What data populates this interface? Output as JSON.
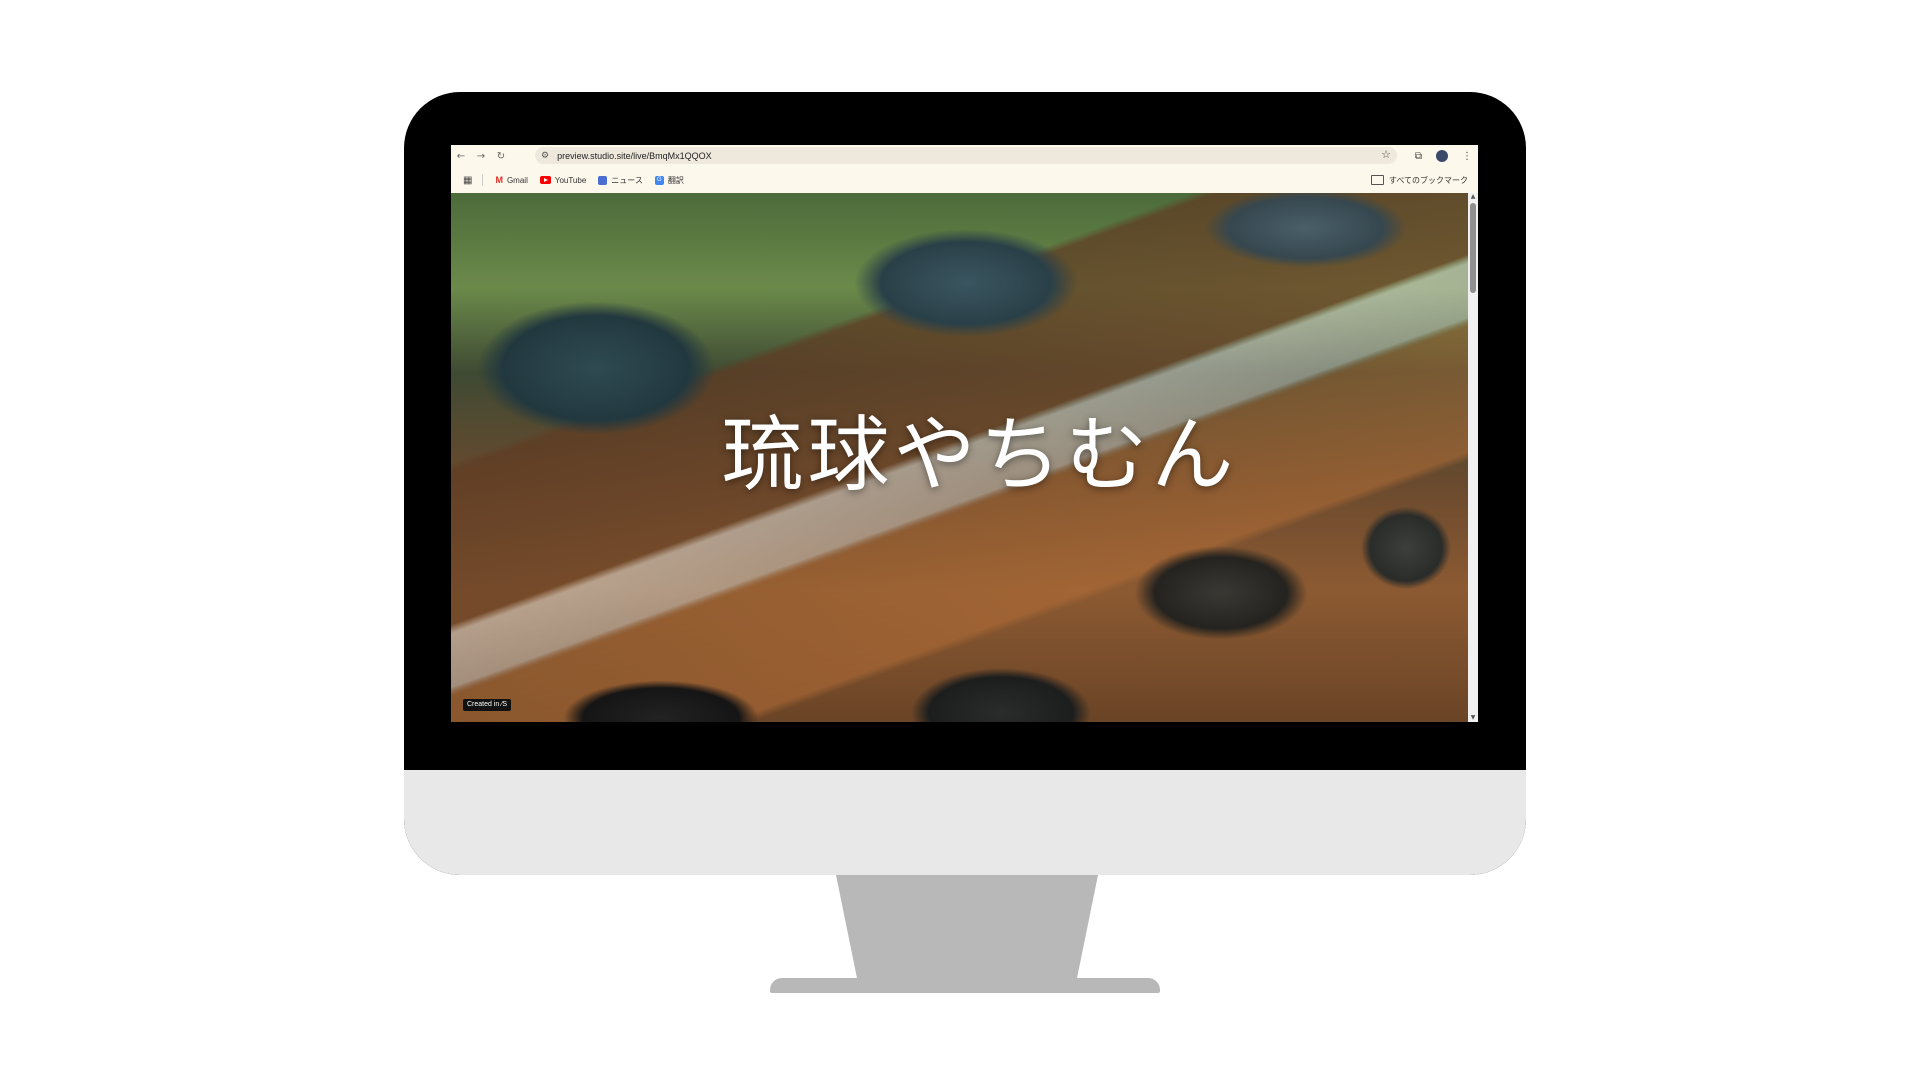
{
  "browser": {
    "nav": {
      "back_icon": "←",
      "forward_icon": "→",
      "reload_icon": "↻"
    },
    "url": "preview.studio.site/live/BmqMx1QQOX",
    "bookmarks": [
      {
        "icon": "gmail-icon",
        "label": "Gmail"
      },
      {
        "icon": "youtube-icon",
        "label": "YouTube"
      },
      {
        "icon": "news-icon",
        "label": "ニュース"
      },
      {
        "icon": "translate-icon",
        "label": "翻訳"
      }
    ],
    "all_bookmarks_label": "すべてのブックマーク"
  },
  "page": {
    "hero_title": "琉球やちむん",
    "created_badge": "Created in ⁄S"
  }
}
